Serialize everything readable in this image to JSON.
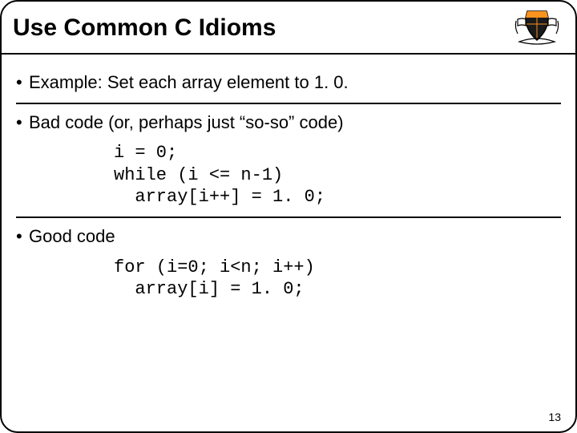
{
  "title": "Use Common C Idioms",
  "bullets": {
    "b1": "Example: Set each array element to 1. 0.",
    "b2": "Bad code (or, perhaps just “so-so” code)",
    "b3": "Good code"
  },
  "code": {
    "bad": "i = 0;\nwhile (i <= n-1)\n  array[i++] = 1. 0;",
    "good": "for (i=0; i<n; i++)\n  array[i] = 1. 0;"
  },
  "page_number": "13",
  "logo": "princeton-shield-icon"
}
